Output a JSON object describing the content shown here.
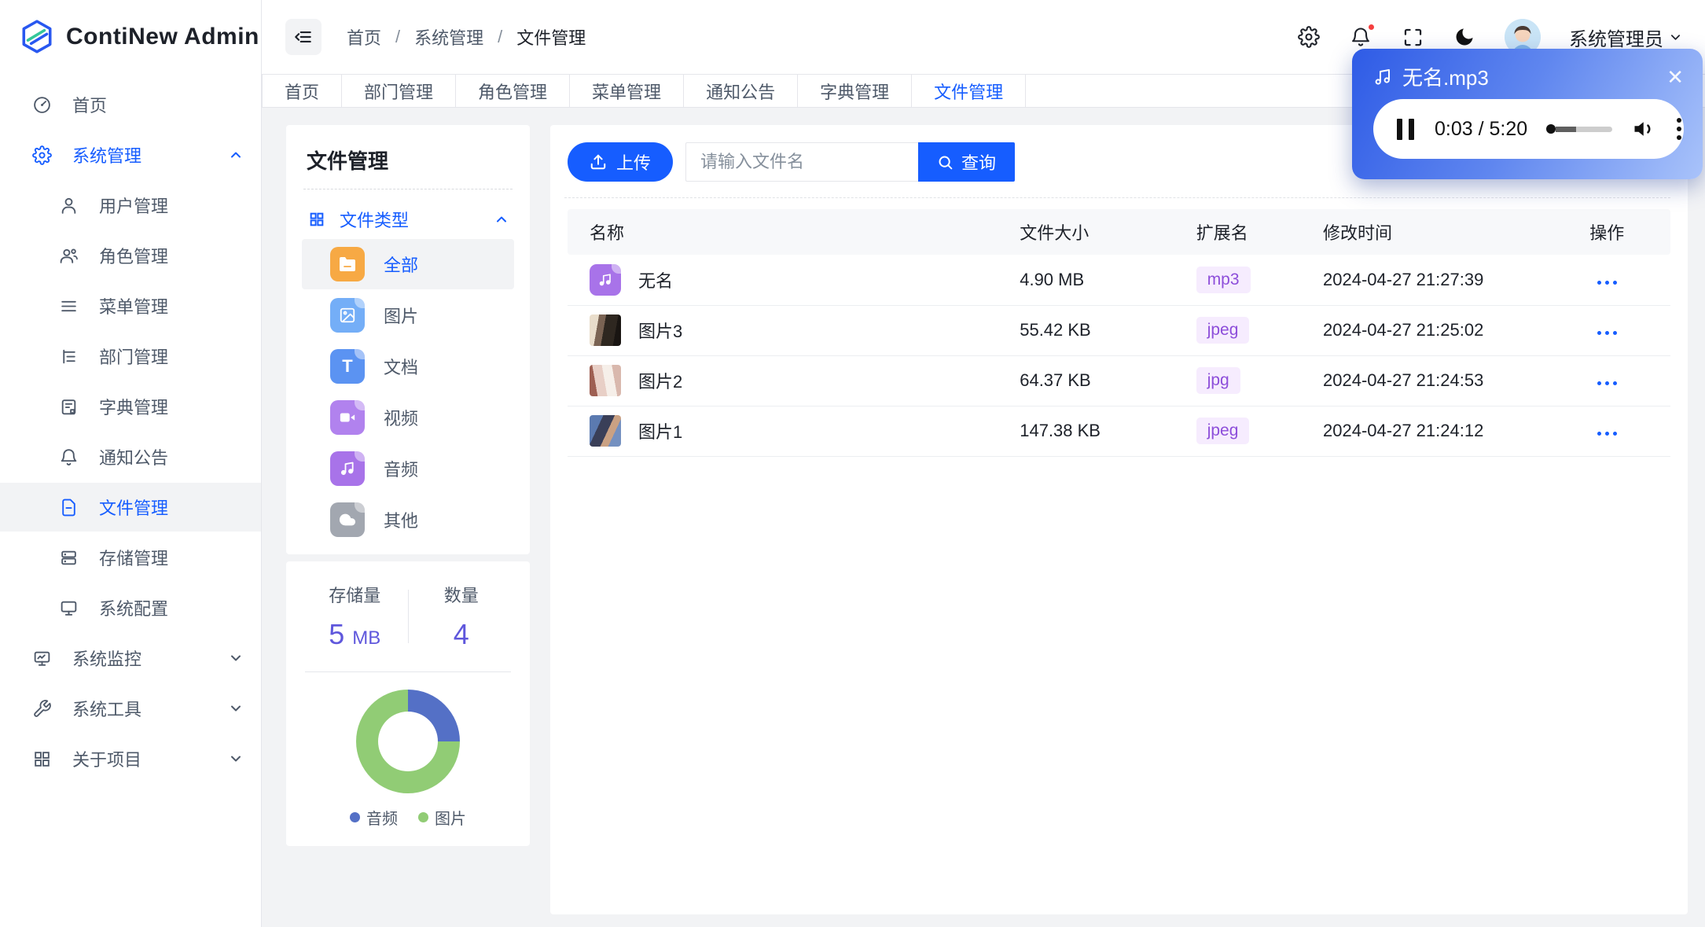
{
  "app": {
    "name": "ContiNew Admin",
    "primary_color": "#165dff"
  },
  "header": {
    "breadcrumb": [
      "首页",
      "系统管理",
      "文件管理"
    ],
    "separator": "/",
    "user_name": "系统管理员"
  },
  "sidebar": {
    "items": [
      {
        "label": "首页"
      },
      {
        "label": "系统管理"
      },
      {
        "label": "用户管理"
      },
      {
        "label": "角色管理"
      },
      {
        "label": "菜单管理"
      },
      {
        "label": "部门管理"
      },
      {
        "label": "字典管理"
      },
      {
        "label": "通知公告"
      },
      {
        "label": "文件管理"
      },
      {
        "label": "存储管理"
      },
      {
        "label": "系统配置"
      },
      {
        "label": "系统监控"
      },
      {
        "label": "系统工具"
      },
      {
        "label": "关于项目"
      }
    ],
    "active_item": "文件管理",
    "expanded_item": "系统管理"
  },
  "tabs": {
    "items": [
      "首页",
      "部门管理",
      "角色管理",
      "菜单管理",
      "通知公告",
      "字典管理",
      "文件管理"
    ],
    "active": "文件管理"
  },
  "file_panel": {
    "title": "文件管理",
    "tree_header": "文件类型",
    "types": [
      {
        "label": "全部",
        "selected": true
      },
      {
        "label": "图片"
      },
      {
        "label": "文档"
      },
      {
        "label": "视频"
      },
      {
        "label": "音频"
      },
      {
        "label": "其他"
      }
    ]
  },
  "stats": {
    "storage_label": "存储量",
    "storage_value": "5",
    "storage_unit": "MB",
    "count_label": "数量",
    "count_value": "4"
  },
  "chart_data": {
    "type": "pie",
    "donut": true,
    "categories": [
      "音频",
      "图片"
    ],
    "values": [
      1,
      3
    ],
    "percentages": [
      25,
      75
    ],
    "colors": [
      "#5470c6",
      "#91cc75"
    ],
    "legend_position": "bottom",
    "title": ""
  },
  "toolbar": {
    "upload_label": "上传",
    "search_placeholder": "请输入文件名",
    "query_label": "查询"
  },
  "table": {
    "columns": [
      "名称",
      "文件大小",
      "扩展名",
      "修改时间",
      "操作"
    ],
    "rows": [
      {
        "name": "无名",
        "size": "4.90 MB",
        "ext": "mp3",
        "time": "2024-04-27 21:27:39"
      },
      {
        "name": "图片3",
        "size": "55.42 KB",
        "ext": "jpeg",
        "time": "2024-04-27 21:25:02"
      },
      {
        "name": "图片2",
        "size": "64.37 KB",
        "ext": "jpg",
        "time": "2024-04-27 21:24:53"
      },
      {
        "name": "图片1",
        "size": "147.38 KB",
        "ext": "jpeg",
        "time": "2024-04-27 21:24:12"
      }
    ]
  },
  "player": {
    "title": "无名.mp3",
    "time": "0:03 / 5:20",
    "close_glyph": "✕",
    "state": "playing"
  }
}
